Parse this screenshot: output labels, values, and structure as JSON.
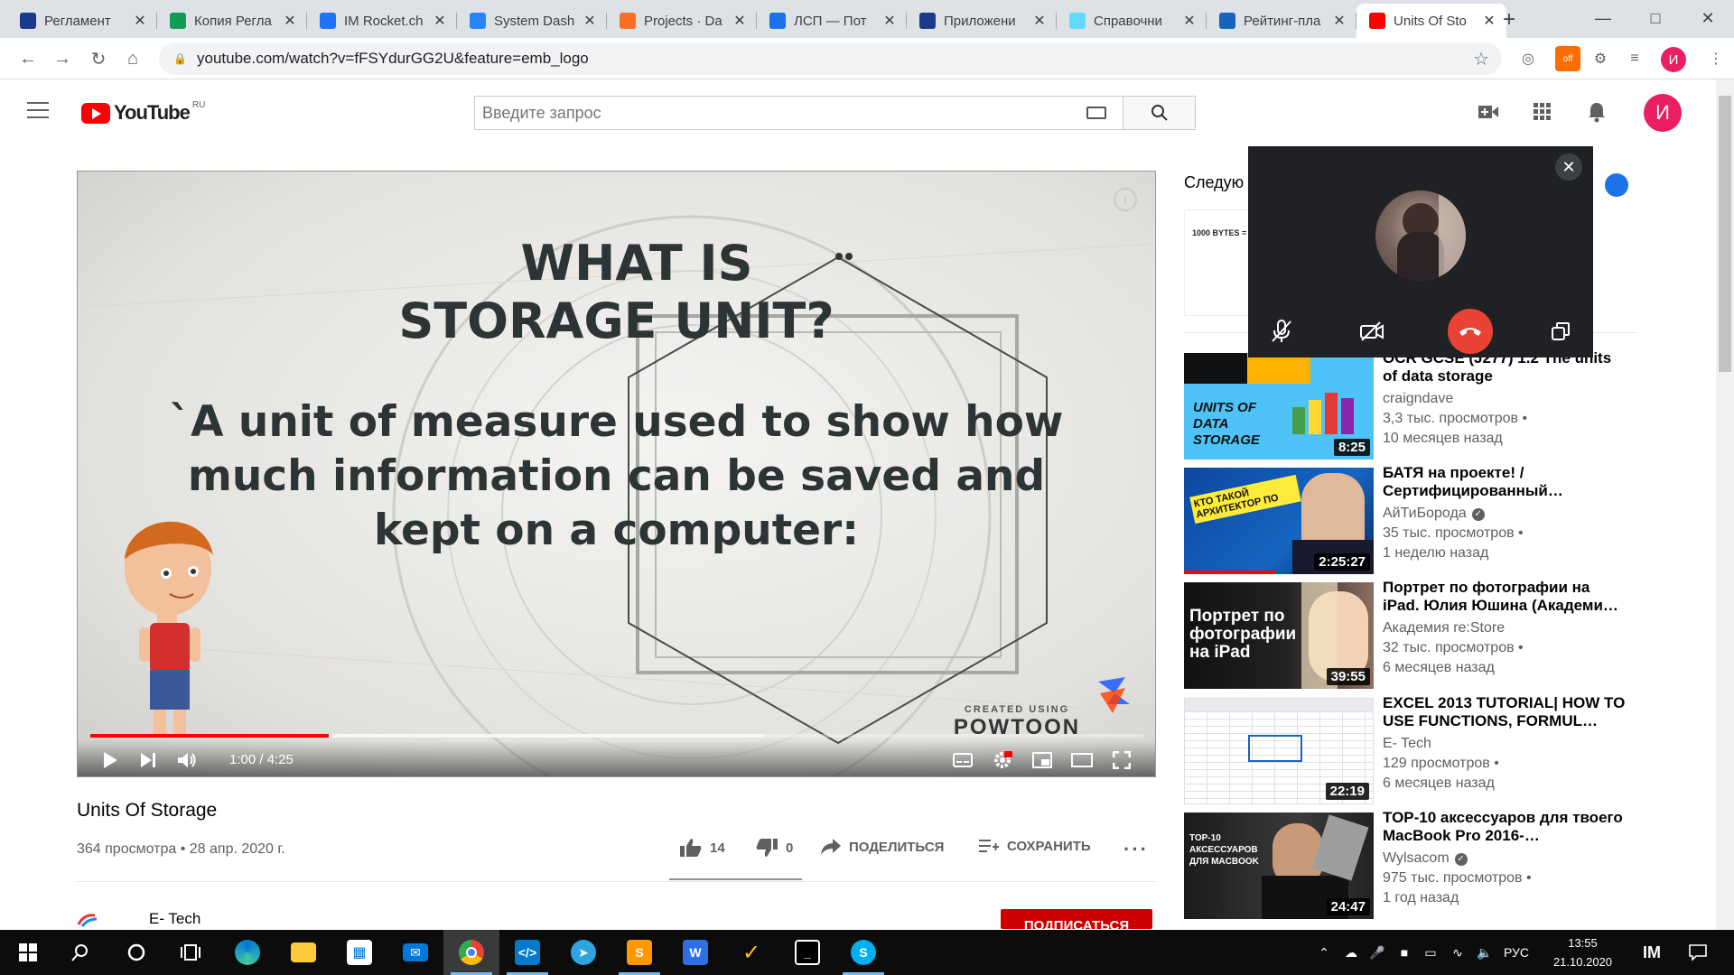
{
  "browser": {
    "tabs": [
      {
        "title": "Регламент",
        "icon": "im-icon",
        "color": "#1b3a8c"
      },
      {
        "title": "Копия Регла",
        "icon": "sheets-icon",
        "color": "#0f9d58"
      },
      {
        "title": "IM Rocket.ch",
        "icon": "rocketchat-icon",
        "color": "#1d74f5"
      },
      {
        "title": "System Dash",
        "icon": "jira-icon",
        "color": "#2684ff"
      },
      {
        "title": "Projects · Da",
        "icon": "gitlab-icon",
        "color": "#fc6d26"
      },
      {
        "title": "ЛСП — Пот",
        "icon": "chat-icon",
        "color": "#1a73e8"
      },
      {
        "title": "Приложени",
        "icon": "im-icon",
        "color": "#1b3a8c"
      },
      {
        "title": "Справочни",
        "icon": "react-icon",
        "color": "#61dafb"
      },
      {
        "title": "Рейтинг-пла",
        "icon": "building-icon",
        "color": "#1565c0"
      },
      {
        "title": "Units Of Sto",
        "icon": "youtube-icon",
        "color": "#ff0000",
        "active": true
      }
    ],
    "url": "youtube.com/watch?v=fFSYdurGG2U&feature=emb_logo",
    "profile_initial": "И",
    "extension_badge": "off"
  },
  "youtube": {
    "region": "RU",
    "logo_text": "YouTube",
    "search_placeholder": "Введите запрос",
    "avatar_initial": "И"
  },
  "video": {
    "slide_heading_1": "WHAT IS",
    "slide_heading_2": "STORAGE UNIT?",
    "slide_body": [
      "`A unit of measure used to show how",
      "much information can be saved and",
      "kept on a computer:"
    ],
    "watermark_top": "CREATED USING",
    "watermark_brand": "POWTOON",
    "current_time": "1:00",
    "duration": "4:25",
    "time_text": "1:00 / 4:25",
    "progress_played": 0.226,
    "progress_loaded": 0.64,
    "title": "Units Of Storage",
    "meta": "364 просмотра • 28 апр. 2020 г.",
    "likes": "14",
    "dislikes": "0",
    "share_label": "ПОДЕЛИТЬСЯ",
    "save_label": "СОХРАНИТЬ",
    "channel": "E- Tech",
    "subscribe_label": "ПОДПИСАТЬСЯ"
  },
  "sidebar": {
    "up_next_label": "Следую",
    "first_card_text": "1000 BYTES =",
    "recommendations": [
      {
        "title": "OCR GCSE (J277) 1.2 The units of data storage",
        "channel": "craigndave",
        "verified": false,
        "views": "3,3 тыс. просмотров •",
        "age": "10 месяцев назад",
        "duration": "8:25",
        "thumb_text": "UNITS OF DATA STORAGE"
      },
      {
        "title": "БАТЯ на проекте! / Сертифицированный…",
        "channel": "АйТиБорода",
        "verified": true,
        "views": "35 тыс. просмотров •",
        "age": "1 неделю назад",
        "duration": "2:25:27",
        "thumb_text": "КТО ТАКОЙ АРХИТЕКТОР ПО",
        "watched": 0.48
      },
      {
        "title": "Портрет по фотографии на iPad. Юлия Юшина (Академи…",
        "channel": "Академия re:Store",
        "verified": false,
        "views": "32 тыс. просмотров •",
        "age": "6 месяцев назад",
        "duration": "39:55",
        "thumb_text": "Портрет по фотографии на iPad"
      },
      {
        "title": "EXCEL 2013 TUTORIAL| HOW TO USE FUNCTIONS, FORMUL…",
        "channel": "E- Tech",
        "verified": false,
        "views": "129 просмотров •",
        "age": "6 месяцев назад",
        "duration": "22:19",
        "thumb_text": ""
      },
      {
        "title": "TOP-10 аксессуаров для твоего MacBook Pro 2016-…",
        "channel": "Wylsacom",
        "verified": true,
        "views": "975 тыс. просмотров •",
        "age": "1 год назад",
        "duration": "24:47",
        "thumb_text": "ТОР-10 АКСЕССУАРОВ ДЛЯ MACBOOK"
      }
    ]
  },
  "call_overlay": {
    "close_icon": "close-icon",
    "buttons": [
      "mic-off-icon",
      "camera-off-icon",
      "hang-up-icon",
      "popout-icon"
    ]
  },
  "taskbar": {
    "apps": [
      "start-icon",
      "search-icon",
      "cortana-icon",
      "taskview-icon",
      "edge-icon",
      "explorer-icon",
      "store-icon",
      "mail-icon",
      "chrome-icon",
      "vscode-icon",
      "telegram-icon",
      "sublime-icon",
      "wps-icon",
      "todo-icon",
      "terminal-icon",
      "skype-icon"
    ],
    "language": "РУС",
    "time": "13:55",
    "date": "21.10.2020"
  },
  "colors": {
    "yt_red": "#ff0000",
    "subscribe_red": "#cc0000",
    "call_bg": "#202124",
    "hangup_red": "#ea4335",
    "taskbar_bg": "#0c0c0c"
  }
}
